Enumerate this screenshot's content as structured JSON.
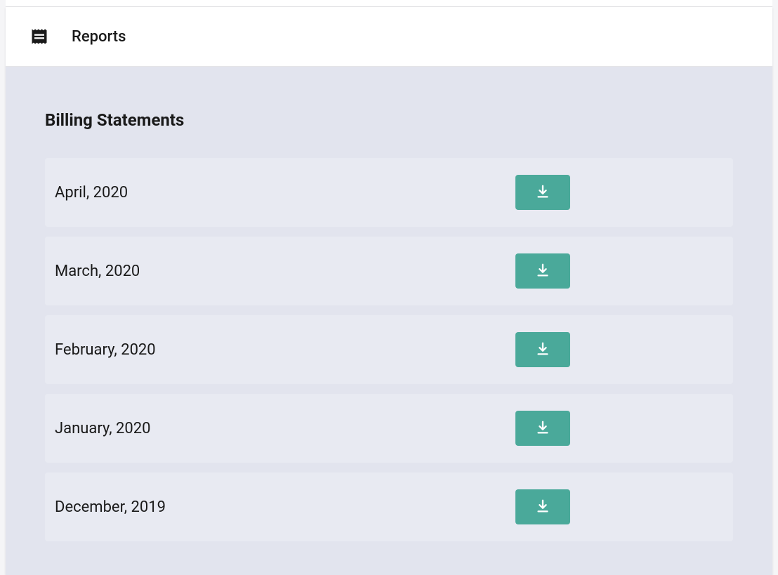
{
  "header": {
    "title": "Reports"
  },
  "section": {
    "title": "Billing Statements"
  },
  "statements": [
    {
      "label": "April, 2020"
    },
    {
      "label": "March, 2020"
    },
    {
      "label": "February, 2020"
    },
    {
      "label": "January, 2020"
    },
    {
      "label": "December, 2019"
    }
  ]
}
